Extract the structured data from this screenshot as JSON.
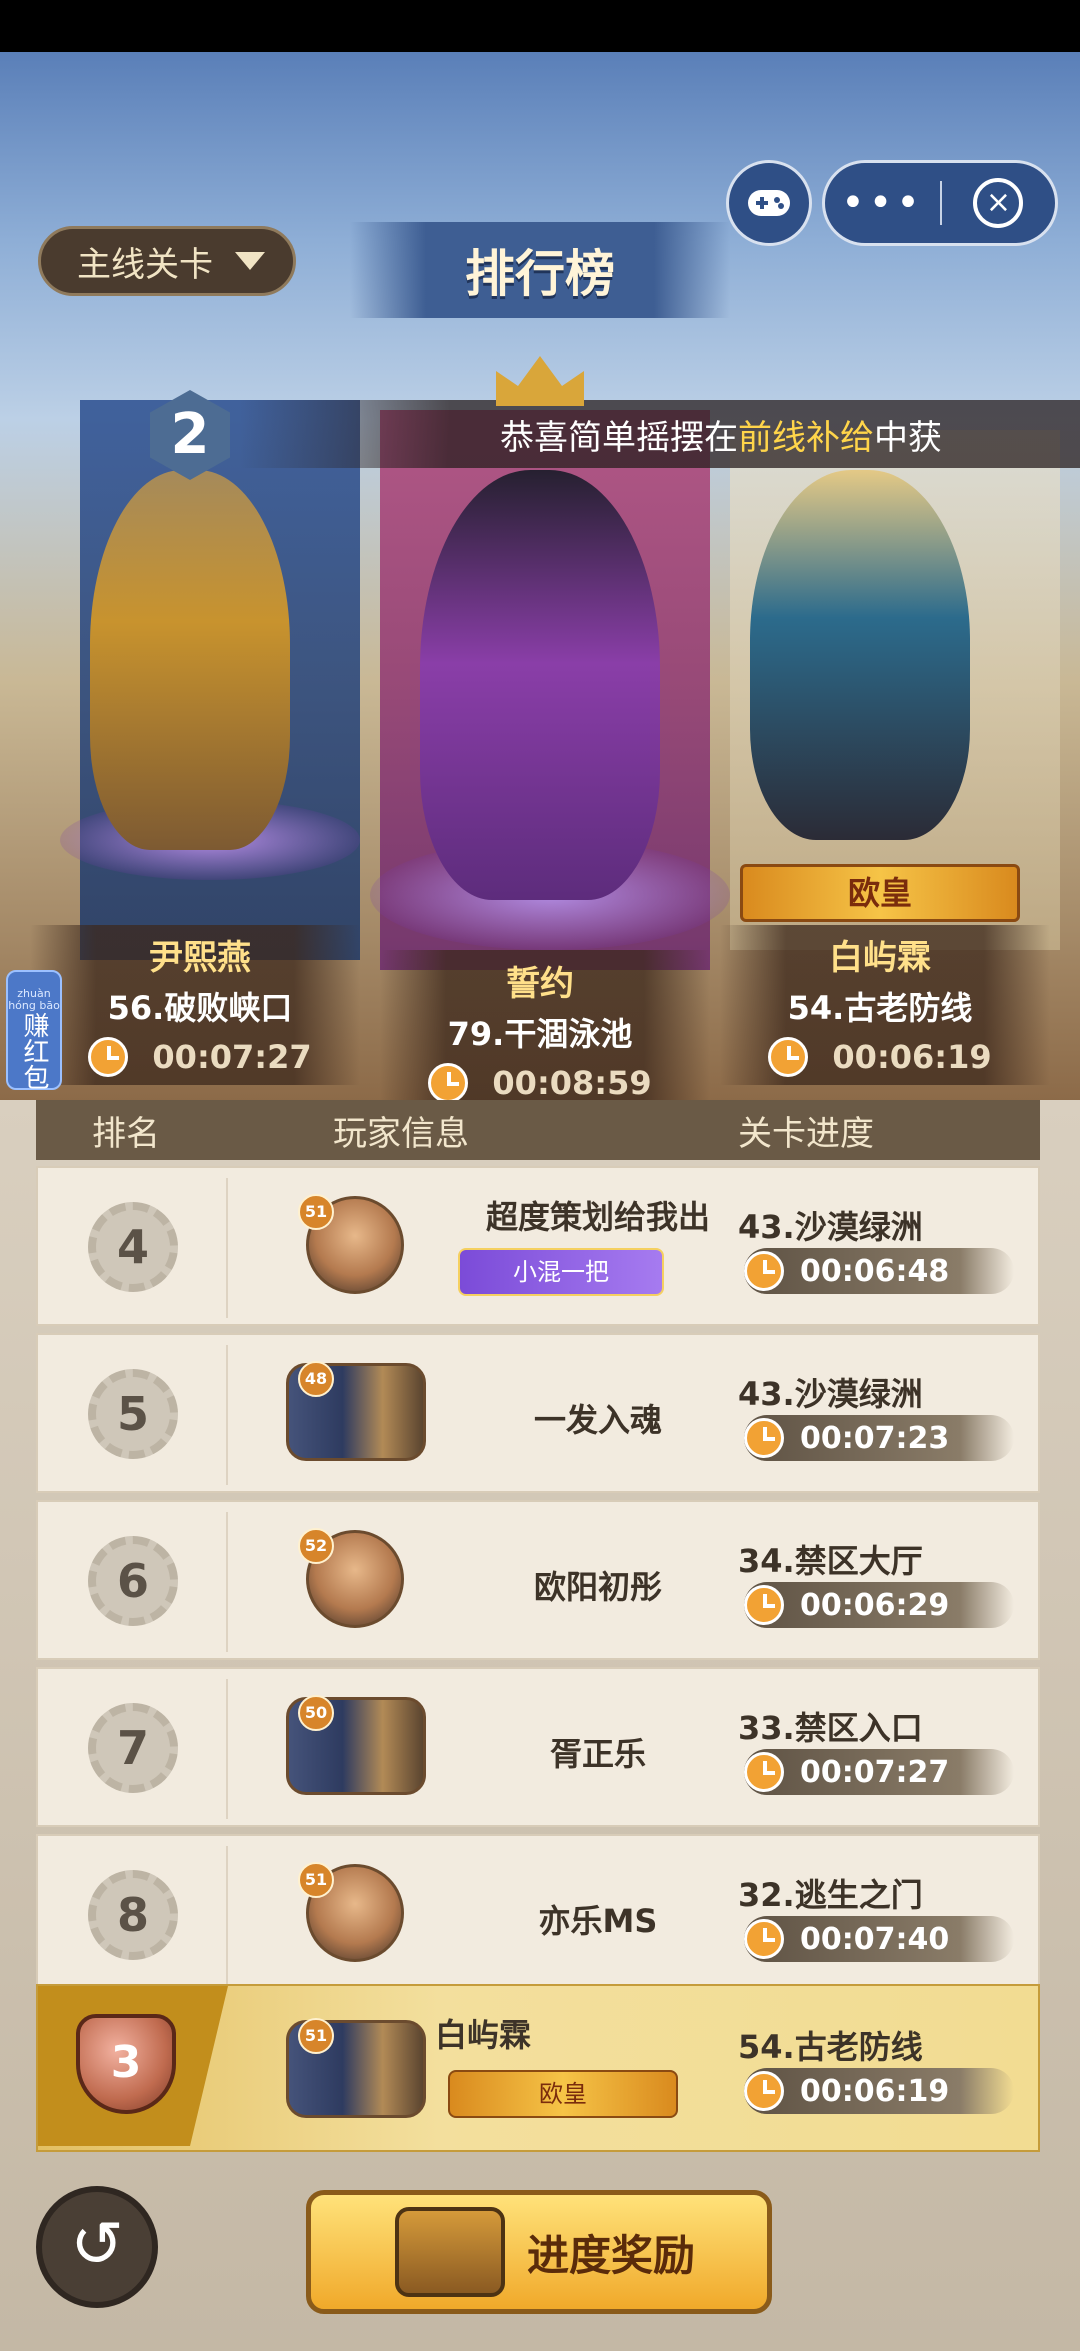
{
  "selector": {
    "label": "主线关卡"
  },
  "title": "排行榜",
  "top_rank_badge": "2",
  "congrats": {
    "prefix": "恭喜简单摇摆在",
    "highlight": "前线补给",
    "suffix": "中获"
  },
  "capsule": {
    "more": "•••",
    "close": "×"
  },
  "red_packet": {
    "pinyin": "zhuàn  hóng  bāo",
    "text": "赚红包"
  },
  "podium": [
    {
      "name": "尹熙燕",
      "stage": "56.破败峡口",
      "time": "00:07:27"
    },
    {
      "name": "誓约",
      "stage": "79.干涸泳池",
      "time": "00:08:59"
    },
    {
      "name": "白屿霖",
      "stage": "54.古老防线",
      "time": "00:06:19",
      "tag": "欧皇"
    }
  ],
  "table": {
    "headers": [
      "排名",
      "玩家信息",
      "关卡进度"
    ],
    "rows": [
      {
        "rank": "4",
        "level": "51",
        "name": "超度策划给我出",
        "tag": "小混一把",
        "stage": "43.沙漠绿洲",
        "time": "00:06:48"
      },
      {
        "rank": "5",
        "level": "48",
        "name": "一发入魂",
        "stage": "43.沙漠绿洲",
        "time": "00:07:23"
      },
      {
        "rank": "6",
        "level": "52",
        "name": "欧阳初彤",
        "stage": "34.禁区大厅",
        "time": "00:06:29"
      },
      {
        "rank": "7",
        "level": "50",
        "name": "胥正乐",
        "stage": "33.禁区入口",
        "time": "00:07:27"
      },
      {
        "rank": "8",
        "level": "51",
        "name": "亦乐MS",
        "stage": "32.逃生之门",
        "time": "00:07:40"
      }
    ],
    "me": {
      "rank": "3",
      "level": "51",
      "name": "白屿霖",
      "tag": "欧皇",
      "stage": "54.古老防线",
      "time": "00:06:19"
    }
  },
  "bottom": {
    "back_icon": "↺",
    "reward_label": "进度奖励"
  }
}
